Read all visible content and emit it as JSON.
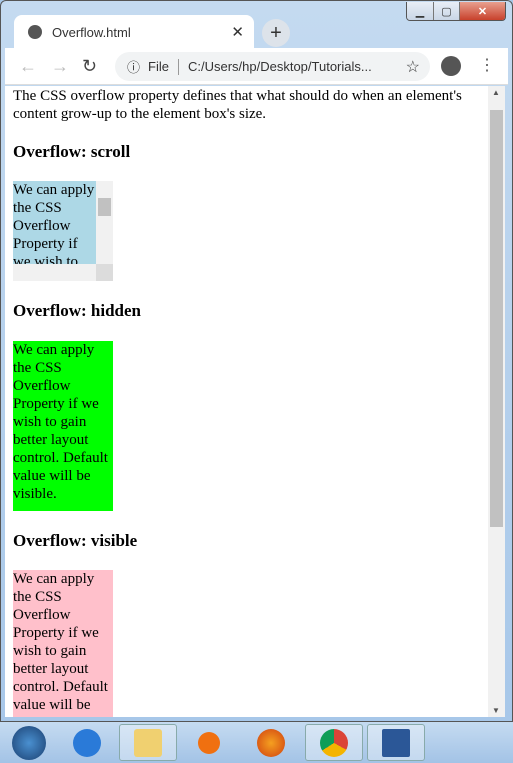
{
  "browser": {
    "tab_title": "Overflow.html",
    "address_prefix": "File",
    "address": "C:/Users/hp/Desktop/Tutorials..."
  },
  "page": {
    "intro": "The CSS overflow property defines that what should do when an element's content grow-up to the element box's size.",
    "sections": [
      {
        "heading": "Overflow: scroll",
        "text": "We can apply the CSS Overflow Property if we wish to gain better layout control. Default value will be visible.",
        "color": "#add8e6"
      },
      {
        "heading": "Overflow: hidden",
        "text": "We can apply the CSS Overflow Property if we wish to gain better layout control. Default value will be visible.",
        "color": "#00ff00"
      },
      {
        "heading": "Overflow: visible",
        "text": "We can apply the CSS Overflow Property if we wish to gain better layout control. Default value will be visible.",
        "color": "#ffc0cb"
      }
    ]
  },
  "taskbar": [
    "start",
    "internet-explorer",
    "file-explorer",
    "media-player",
    "firefox",
    "chrome",
    "word"
  ]
}
